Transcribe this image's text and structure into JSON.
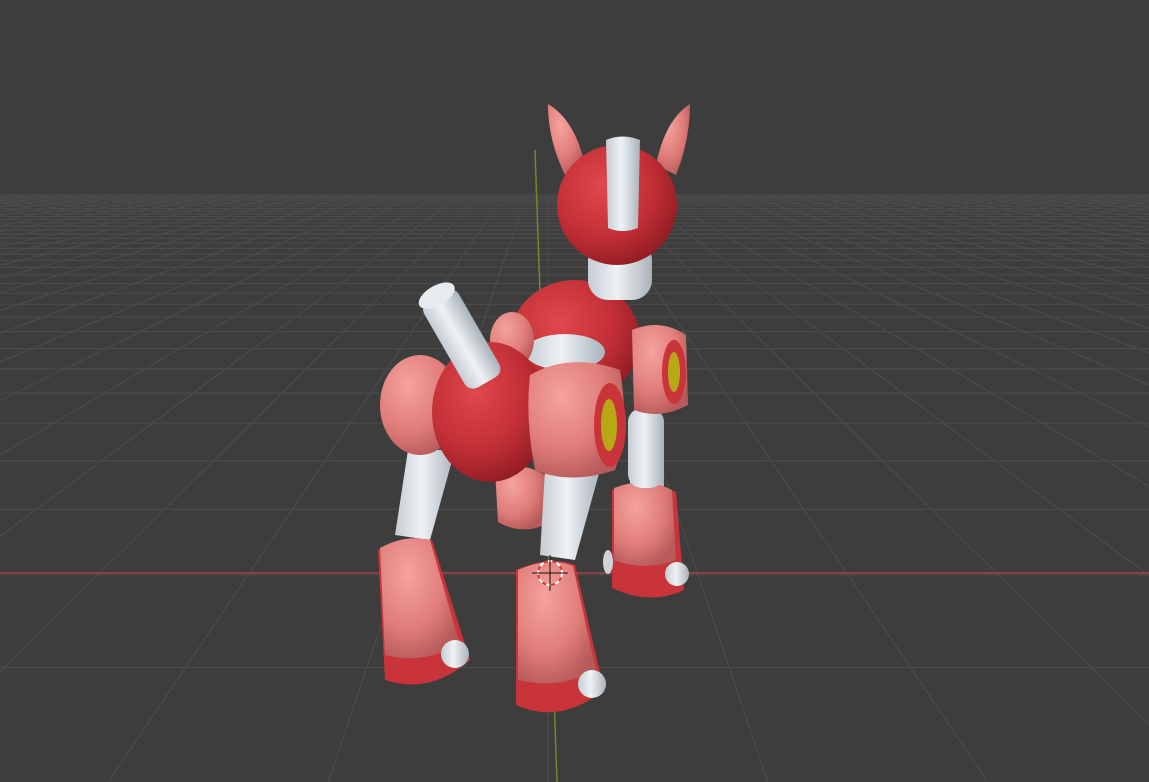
{
  "viewport": {
    "background_color": "#3d3d3d",
    "grid_color": "#4b4b4b",
    "x_axis_color": "#a8434a",
    "y_axis_color": "#6d8a2c"
  },
  "model": {
    "body_red": "#c8343a",
    "armor_pink": "#e48380",
    "joint_white": "#dde3e8",
    "eye_yellow": "#b8a818"
  },
  "icons": {
    "cursor": "3d-cursor-icon"
  }
}
